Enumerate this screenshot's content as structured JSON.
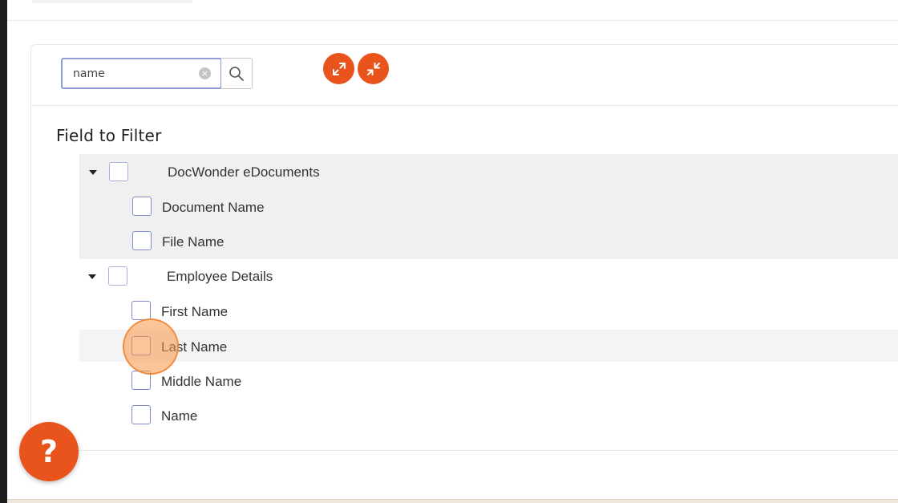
{
  "search": {
    "value": "name",
    "clear_glyph": "×",
    "icon": "search-icon"
  },
  "toolbar": {
    "expand_icon": "expand-arrows-icon",
    "collapse_icon": "collapse-arrows-icon"
  },
  "section": {
    "title": "Field to Filter"
  },
  "tree": {
    "groups": [
      {
        "label": "DocWonder eDocuments",
        "expanded": true,
        "children": [
          {
            "label": "Document Name",
            "checked": false
          },
          {
            "label": "File Name",
            "checked": false
          }
        ]
      },
      {
        "label": "Employee Details",
        "expanded": true,
        "children": [
          {
            "label": "First Name",
            "checked": false
          },
          {
            "label": "Last Name",
            "checked": false
          },
          {
            "label": "Middle Name",
            "checked": false
          },
          {
            "label": "Name",
            "checked": false
          }
        ]
      }
    ]
  },
  "help": {
    "label": "?"
  },
  "colors": {
    "accent": "#e8541b",
    "input_focus_border": "#8f9bd8",
    "checkbox_border": "#7f8bc9",
    "group_background": "#f0f0f0",
    "click_indicator": "#f79646"
  }
}
